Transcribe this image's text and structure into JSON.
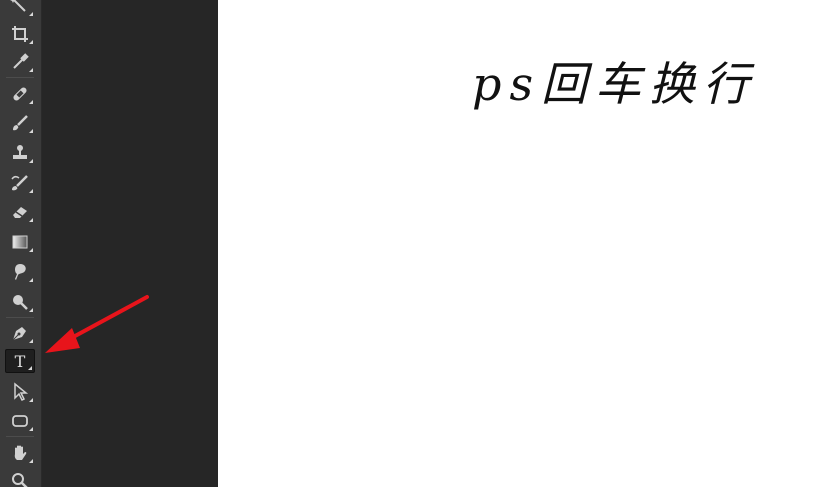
{
  "toolbar": {
    "tools": [
      {
        "name": "magic-wand-tool",
        "icon": "magic-wand-icon"
      },
      {
        "name": "crop-tool",
        "icon": "crop-icon"
      },
      {
        "name": "eyedropper-tool",
        "icon": "eyedropper-icon"
      },
      {
        "name": "healing-brush-tool",
        "icon": "bandage-icon"
      },
      {
        "name": "brush-tool",
        "icon": "brush-icon"
      },
      {
        "name": "clone-stamp-tool",
        "icon": "stamp-icon"
      },
      {
        "name": "history-brush-tool",
        "icon": "history-brush-icon"
      },
      {
        "name": "eraser-tool",
        "icon": "eraser-icon"
      },
      {
        "name": "gradient-tool",
        "icon": "gradient-icon"
      },
      {
        "name": "blur-tool",
        "icon": "blur-icon"
      },
      {
        "name": "dodge-tool",
        "icon": "dodge-icon"
      },
      {
        "name": "pen-tool",
        "icon": "pen-icon"
      },
      {
        "name": "type-tool",
        "icon": "type-icon",
        "active": true,
        "label": "T"
      },
      {
        "name": "path-selection-tool",
        "icon": "arrow-pointer-icon"
      },
      {
        "name": "shape-tool",
        "icon": "rounded-rectangle-icon"
      },
      {
        "name": "hand-tool",
        "icon": "hand-icon"
      },
      {
        "name": "zoom-tool",
        "icon": "zoom-icon"
      }
    ]
  },
  "canvas": {
    "text": "ps回车换行"
  },
  "annotation": {
    "arrow_color": "#e8141b",
    "points_to": "type-tool"
  },
  "colors": {
    "toolbar_bg": "#3a3a3a",
    "panel_bg": "#262626",
    "canvas_bg": "#ffffff",
    "icon": "#d0d0d0"
  }
}
